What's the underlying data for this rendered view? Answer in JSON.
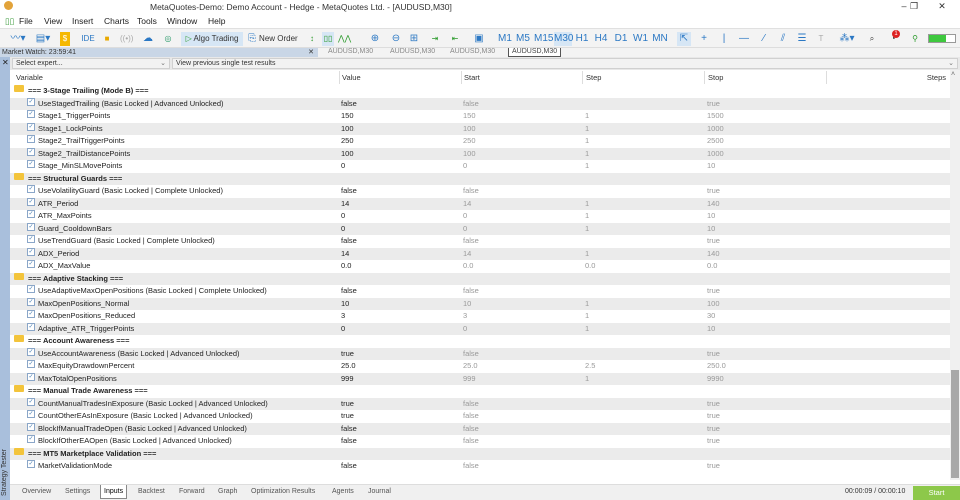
{
  "window": {
    "title": "MetaQuotes-Demo: Demo Account - Hedge - MetaQuotes Ltd. - [AUDUSD,M30]",
    "minimize": "–",
    "maximize": "❐",
    "close": "✕"
  },
  "menu": [
    "File",
    "View",
    "Insert",
    "Charts",
    "Tools",
    "Window",
    "Help"
  ],
  "toolbar": {
    "ide": "IDE",
    "algo_trading": "Algo Trading",
    "new_order": "New Order",
    "timeframes": [
      "M1",
      "M5",
      "M15",
      "M30",
      "H1",
      "H4",
      "D1",
      "W1",
      "MN"
    ],
    "active_timeframe": "M30",
    "notification_count": "1"
  },
  "market_watch": {
    "label": "Market Watch: 23:59:41",
    "close": "✕"
  },
  "chart_tabs": [
    "AUDUSD,M30",
    "AUDUSD,M30",
    "AUDUSD,M30",
    "AUDUSD,M30"
  ],
  "tester": {
    "side_label": "Strategy Tester",
    "expert_placeholder": "Select expert...",
    "previous_results": "View previous single test results"
  },
  "columns": [
    "Variable",
    "Value",
    "Start",
    "Step",
    "Stop",
    "Steps"
  ],
  "rows": [
    {
      "group": "=== 3-Stage Trailing (Mode B) ==="
    },
    {
      "name": "UseStagedTrailing (Basic Locked | Advanced Unlocked)",
      "value": "false",
      "start": "false",
      "step": "",
      "stop": "true"
    },
    {
      "name": "Stage1_TriggerPoints",
      "value": "150",
      "start": "150",
      "step": "1",
      "stop": "1500"
    },
    {
      "name": "Stage1_LockPoints",
      "value": "100",
      "start": "100",
      "step": "1",
      "stop": "1000"
    },
    {
      "name": "Stage2_TrailTriggerPoints",
      "value": "250",
      "start": "250",
      "step": "1",
      "stop": "2500"
    },
    {
      "name": "Stage2_TrailDistancePoints",
      "value": "100",
      "start": "100",
      "step": "1",
      "stop": "1000"
    },
    {
      "name": "Stage_MinSLMovePoints",
      "value": "0",
      "start": "0",
      "step": "1",
      "stop": "10"
    },
    {
      "group": "=== Structural Guards ==="
    },
    {
      "name": "UseVolatilityGuard (Basic Locked | Complete Unlocked)",
      "value": "false",
      "start": "false",
      "step": "",
      "stop": "true"
    },
    {
      "name": "ATR_Period",
      "value": "14",
      "start": "14",
      "step": "1",
      "stop": "140"
    },
    {
      "name": "ATR_MaxPoints",
      "value": "0",
      "start": "0",
      "step": "1",
      "stop": "10"
    },
    {
      "name": "Guard_CooldownBars",
      "value": "0",
      "start": "0",
      "step": "1",
      "stop": "10"
    },
    {
      "name": "UseTrendGuard (Basic Locked | Complete Unlocked)",
      "value": "false",
      "start": "false",
      "step": "",
      "stop": "true"
    },
    {
      "name": "ADX_Period",
      "value": "14",
      "start": "14",
      "step": "1",
      "stop": "140"
    },
    {
      "name": "ADX_MaxValue",
      "value": "0.0",
      "start": "0.0",
      "step": "0.0",
      "stop": "0.0"
    },
    {
      "group": "=== Adaptive Stacking ==="
    },
    {
      "name": "UseAdaptiveMaxOpenPositions (Basic Locked | Complete Unlocked)",
      "value": "false",
      "start": "false",
      "step": "",
      "stop": "true"
    },
    {
      "name": "MaxOpenPositions_Normal",
      "value": "10",
      "start": "10",
      "step": "1",
      "stop": "100"
    },
    {
      "name": "MaxOpenPositions_Reduced",
      "value": "3",
      "start": "3",
      "step": "1",
      "stop": "30"
    },
    {
      "name": "Adaptive_ATR_TriggerPoints",
      "value": "0",
      "start": "0",
      "step": "1",
      "stop": "10"
    },
    {
      "group": "=== Account Awareness ==="
    },
    {
      "name": "UseAccountAwareness (Basic Locked | Advanced Unlocked)",
      "value": "true",
      "start": "false",
      "step": "",
      "stop": "true"
    },
    {
      "name": "MaxEquityDrawdownPercent",
      "value": "25.0",
      "start": "25.0",
      "step": "2.5",
      "stop": "250.0"
    },
    {
      "name": "MaxTotalOpenPositions",
      "value": "999",
      "start": "999",
      "step": "1",
      "stop": "9990"
    },
    {
      "group": "=== Manual Trade Awareness ==="
    },
    {
      "name": "CountManualTradesInExposure (Basic Locked | Advanced Unlocked)",
      "value": "true",
      "start": "false",
      "step": "",
      "stop": "true"
    },
    {
      "name": "CountOtherEAsInExposure (Basic Locked | Advanced Unlocked)",
      "value": "true",
      "start": "false",
      "step": "",
      "stop": "true"
    },
    {
      "name": "BlockIfManualTradeOpen (Basic Locked | Advanced Unlocked)",
      "value": "false",
      "start": "false",
      "step": "",
      "stop": "true"
    },
    {
      "name": "BlockIfOtherEAOpen (Basic Locked | Advanced Unlocked)",
      "value": "false",
      "start": "false",
      "step": "",
      "stop": "true"
    },
    {
      "group": "=== MT5 Marketplace Validation ==="
    },
    {
      "name": "MarketValidationMode",
      "value": "false",
      "start": "false",
      "step": "",
      "stop": "true"
    }
  ],
  "bottom_tabs": [
    "Overview",
    "Settings",
    "Inputs",
    "Backtest",
    "Forward",
    "Graph",
    "Optimization Results",
    "Agents",
    "Journal"
  ],
  "active_tab": "Inputs",
  "timer": "00:00:09 / 00:00:10",
  "start_button": "Start",
  "colors": {
    "accent": "#8dc84a",
    "sidebar": "#a9bfdc",
    "folder": "#f3c43b"
  }
}
